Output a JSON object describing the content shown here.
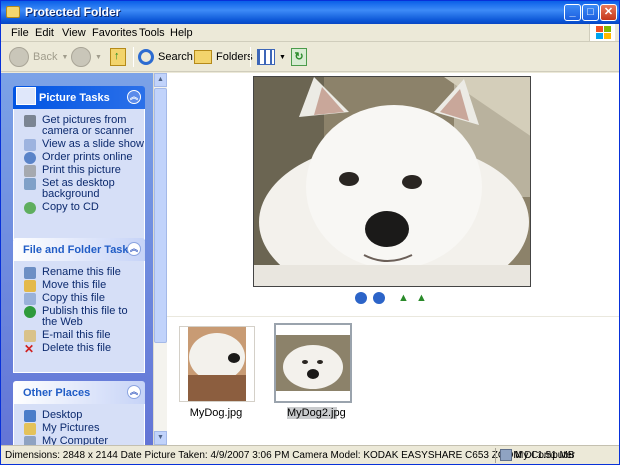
{
  "window": {
    "title": "Protected Folder"
  },
  "menu": [
    "File",
    "Edit",
    "View",
    "Favorites",
    "Tools",
    "Help"
  ],
  "toolbar": {
    "back": "Back",
    "search": "Search",
    "folders": "Folders"
  },
  "panels": {
    "picture_tasks": {
      "title": "Picture Tasks",
      "items": [
        "Get pictures from camera or scanner",
        "View as a slide show",
        "Order prints online",
        "Print this picture",
        "Set as desktop background",
        "Copy to CD"
      ]
    },
    "file_folder_tasks": {
      "title": "File and Folder Tasks",
      "items": [
        "Rename this file",
        "Move this file",
        "Copy this file",
        "Publish this file to the Web",
        "E-mail this file",
        "Delete this file"
      ]
    },
    "other_places": {
      "title": "Other Places",
      "items": [
        "Desktop",
        "My Pictures",
        "My Computer"
      ]
    }
  },
  "thumbnails": [
    {
      "label": "MyDog.jpg",
      "selected": false
    },
    {
      "label": "MyDog2.jpg",
      "selected": true
    }
  ],
  "status": {
    "details": "Dimensions: 2848 x 2144 Date Picture Taken: 4/9/2007 3:06 PM Camera Model: KODAK EASYSHARE C653 ZOOM DI 1.51 MB",
    "location": "My Computer"
  },
  "colors": {
    "title_blue": "#0a5fe8",
    "sidebar_blue": "#7ba2e7",
    "panel_body": "#d6dff7",
    "link_text": "#0c2a6e"
  }
}
